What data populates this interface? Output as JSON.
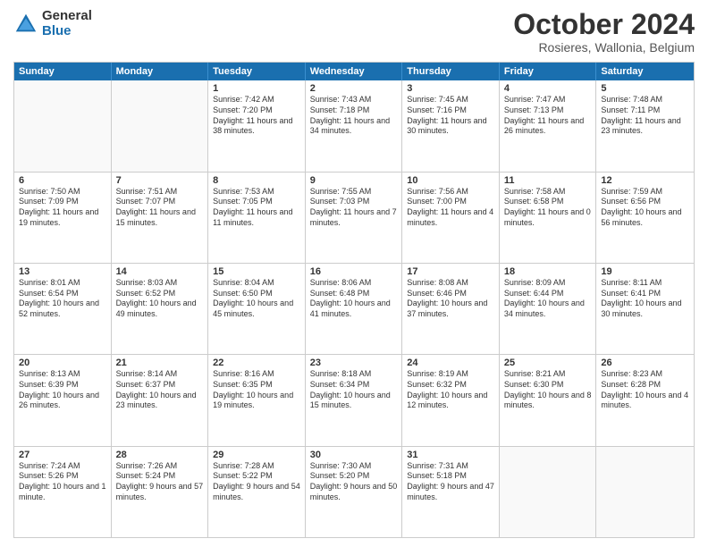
{
  "logo": {
    "general": "General",
    "blue": "Blue"
  },
  "title": "October 2024",
  "location": "Rosieres, Wallonia, Belgium",
  "days": [
    "Sunday",
    "Monday",
    "Tuesday",
    "Wednesday",
    "Thursday",
    "Friday",
    "Saturday"
  ],
  "weeks": [
    [
      {
        "day": "",
        "content": ""
      },
      {
        "day": "",
        "content": ""
      },
      {
        "day": "1",
        "content": "Sunrise: 7:42 AM\nSunset: 7:20 PM\nDaylight: 11 hours and 38 minutes."
      },
      {
        "day": "2",
        "content": "Sunrise: 7:43 AM\nSunset: 7:18 PM\nDaylight: 11 hours and 34 minutes."
      },
      {
        "day": "3",
        "content": "Sunrise: 7:45 AM\nSunset: 7:16 PM\nDaylight: 11 hours and 30 minutes."
      },
      {
        "day": "4",
        "content": "Sunrise: 7:47 AM\nSunset: 7:13 PM\nDaylight: 11 hours and 26 minutes."
      },
      {
        "day": "5",
        "content": "Sunrise: 7:48 AM\nSunset: 7:11 PM\nDaylight: 11 hours and 23 minutes."
      }
    ],
    [
      {
        "day": "6",
        "content": "Sunrise: 7:50 AM\nSunset: 7:09 PM\nDaylight: 11 hours and 19 minutes."
      },
      {
        "day": "7",
        "content": "Sunrise: 7:51 AM\nSunset: 7:07 PM\nDaylight: 11 hours and 15 minutes."
      },
      {
        "day": "8",
        "content": "Sunrise: 7:53 AM\nSunset: 7:05 PM\nDaylight: 11 hours and 11 minutes."
      },
      {
        "day": "9",
        "content": "Sunrise: 7:55 AM\nSunset: 7:03 PM\nDaylight: 11 hours and 7 minutes."
      },
      {
        "day": "10",
        "content": "Sunrise: 7:56 AM\nSunset: 7:00 PM\nDaylight: 11 hours and 4 minutes."
      },
      {
        "day": "11",
        "content": "Sunrise: 7:58 AM\nSunset: 6:58 PM\nDaylight: 11 hours and 0 minutes."
      },
      {
        "day": "12",
        "content": "Sunrise: 7:59 AM\nSunset: 6:56 PM\nDaylight: 10 hours and 56 minutes."
      }
    ],
    [
      {
        "day": "13",
        "content": "Sunrise: 8:01 AM\nSunset: 6:54 PM\nDaylight: 10 hours and 52 minutes."
      },
      {
        "day": "14",
        "content": "Sunrise: 8:03 AM\nSunset: 6:52 PM\nDaylight: 10 hours and 49 minutes."
      },
      {
        "day": "15",
        "content": "Sunrise: 8:04 AM\nSunset: 6:50 PM\nDaylight: 10 hours and 45 minutes."
      },
      {
        "day": "16",
        "content": "Sunrise: 8:06 AM\nSunset: 6:48 PM\nDaylight: 10 hours and 41 minutes."
      },
      {
        "day": "17",
        "content": "Sunrise: 8:08 AM\nSunset: 6:46 PM\nDaylight: 10 hours and 37 minutes."
      },
      {
        "day": "18",
        "content": "Sunrise: 8:09 AM\nSunset: 6:44 PM\nDaylight: 10 hours and 34 minutes."
      },
      {
        "day": "19",
        "content": "Sunrise: 8:11 AM\nSunset: 6:41 PM\nDaylight: 10 hours and 30 minutes."
      }
    ],
    [
      {
        "day": "20",
        "content": "Sunrise: 8:13 AM\nSunset: 6:39 PM\nDaylight: 10 hours and 26 minutes."
      },
      {
        "day": "21",
        "content": "Sunrise: 8:14 AM\nSunset: 6:37 PM\nDaylight: 10 hours and 23 minutes."
      },
      {
        "day": "22",
        "content": "Sunrise: 8:16 AM\nSunset: 6:35 PM\nDaylight: 10 hours and 19 minutes."
      },
      {
        "day": "23",
        "content": "Sunrise: 8:18 AM\nSunset: 6:34 PM\nDaylight: 10 hours and 15 minutes."
      },
      {
        "day": "24",
        "content": "Sunrise: 8:19 AM\nSunset: 6:32 PM\nDaylight: 10 hours and 12 minutes."
      },
      {
        "day": "25",
        "content": "Sunrise: 8:21 AM\nSunset: 6:30 PM\nDaylight: 10 hours and 8 minutes."
      },
      {
        "day": "26",
        "content": "Sunrise: 8:23 AM\nSunset: 6:28 PM\nDaylight: 10 hours and 4 minutes."
      }
    ],
    [
      {
        "day": "27",
        "content": "Sunrise: 7:24 AM\nSunset: 5:26 PM\nDaylight: 10 hours and 1 minute."
      },
      {
        "day": "28",
        "content": "Sunrise: 7:26 AM\nSunset: 5:24 PM\nDaylight: 9 hours and 57 minutes."
      },
      {
        "day": "29",
        "content": "Sunrise: 7:28 AM\nSunset: 5:22 PM\nDaylight: 9 hours and 54 minutes."
      },
      {
        "day": "30",
        "content": "Sunrise: 7:30 AM\nSunset: 5:20 PM\nDaylight: 9 hours and 50 minutes."
      },
      {
        "day": "31",
        "content": "Sunrise: 7:31 AM\nSunset: 5:18 PM\nDaylight: 9 hours and 47 minutes."
      },
      {
        "day": "",
        "content": ""
      },
      {
        "day": "",
        "content": ""
      }
    ]
  ]
}
